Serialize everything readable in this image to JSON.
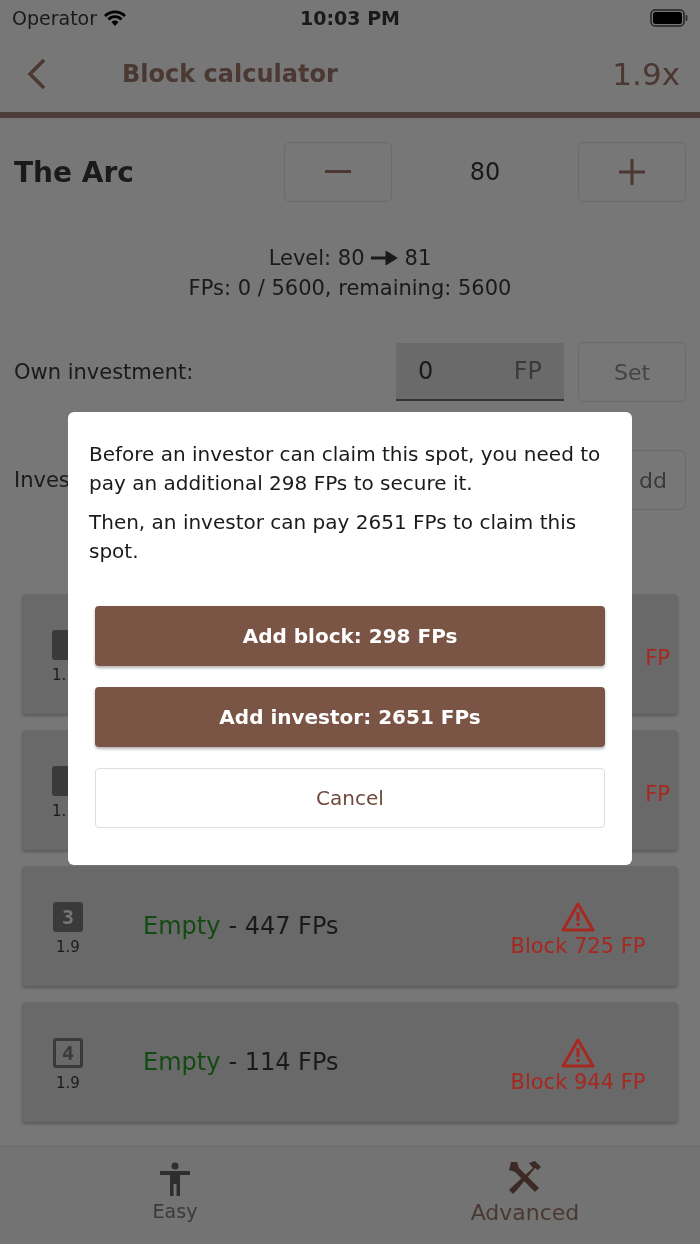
{
  "status_bar": {
    "carrier": "Operator",
    "time": "10:03 PM"
  },
  "header": {
    "title": "Block calculator",
    "multiplier": "1.9x"
  },
  "building": {
    "name": "The Arc",
    "level_value": "80"
  },
  "info": {
    "level_label": "Level:",
    "level_from": "80",
    "level_to": "81",
    "fps": "FPs: 0 / 5600, remaining: 5600"
  },
  "own_investment": {
    "label": "Own investment:",
    "value": "0",
    "unit": "FP",
    "button": "Set"
  },
  "investors": {
    "label": "Inves",
    "button": "dd"
  },
  "rows": [
    {
      "badge_filled": true,
      "factor": "1.",
      "block": "FP"
    },
    {
      "badge_filled": true,
      "factor": "1.",
      "block": "FP"
    },
    {
      "badge_filled": true,
      "badge": "3",
      "factor": "1.9",
      "status": "Empty",
      "amount": "- 447 FPs",
      "block": "Block 725 FP"
    },
    {
      "badge_filled": false,
      "badge": "4",
      "factor": "1.9",
      "status": "Empty",
      "amount": "- 114 FPs",
      "block": "Block 944 FP"
    }
  ],
  "dialog": {
    "paragraphs": [
      "Before an investor can claim this spot, you need to pay an additional 298 FPs to secure it.",
      "Then, an investor can pay 2651 FPs to claim this spot."
    ],
    "buttons": [
      {
        "label": "Add block: 298 FPs",
        "kind": "primary"
      },
      {
        "label": "Add investor: 2651 FPs",
        "kind": "primary"
      },
      {
        "label": "Cancel",
        "kind": "secondary"
      }
    ]
  },
  "tabs": [
    {
      "label": "Easy",
      "selected": false,
      "kind": "person"
    },
    {
      "label": "Advanced",
      "selected": true,
      "kind": "tools"
    }
  ]
}
